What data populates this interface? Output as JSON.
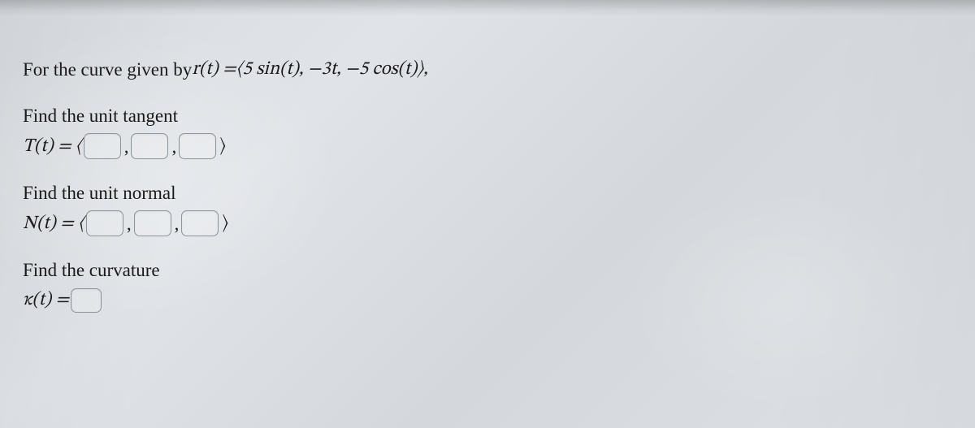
{
  "problem": {
    "intro_prefix": "For the curve given by ",
    "curve_lhs": "r(t) = ",
    "curve_rhs": "⟨5 sin(t), −3t, −5 cos(t)⟩,",
    "tangent": {
      "prompt": "Find the unit tangent",
      "lhs": "T(t) = ⟨",
      "rhs": "⟩"
    },
    "normal": {
      "prompt": "Find the unit normal",
      "lhs": "N(t) = ⟨",
      "rhs": "⟩"
    },
    "curvature": {
      "prompt": "Find the curvature",
      "lhs": "κ(t) = "
    }
  }
}
